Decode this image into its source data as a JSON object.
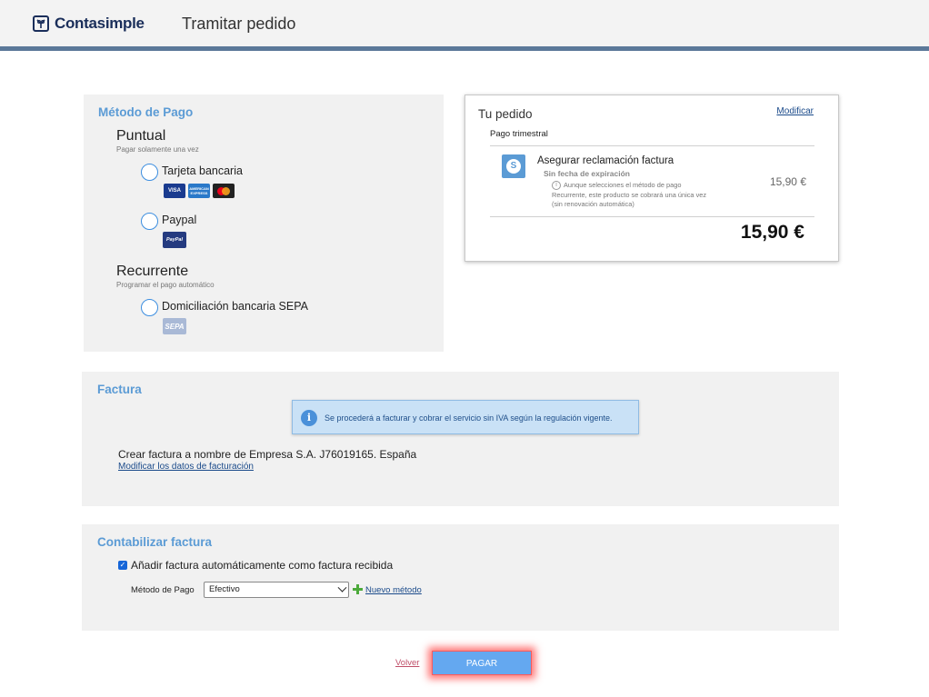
{
  "header": {
    "brand": "Contasimple",
    "title": "Tramitar pedido"
  },
  "payment": {
    "title": "Método de Pago",
    "puntual": {
      "title": "Puntual",
      "subtitle": "Pagar solamente una vez",
      "options": [
        {
          "label": "Tarjeta bancaria",
          "cards": [
            "VISA",
            "AMERICAN EXPRESS",
            "Mastercard"
          ]
        },
        {
          "label": "Paypal",
          "cards": [
            "PayPal"
          ]
        }
      ]
    },
    "recurrente": {
      "title": "Recurrente",
      "subtitle": "Programar el pago automático",
      "options": [
        {
          "label": "Domiciliación bancaria SEPA",
          "cards": [
            "SEPA"
          ]
        }
      ]
    }
  },
  "order": {
    "title": "Tu pedido",
    "modify": "Modificar",
    "period": "Pago trimestral",
    "product": {
      "name": "Asegurar reclamación factura",
      "expiry": "Sin fecha de expiración",
      "note": "Aunque selecciones el método de pago Recurrente, este producto se cobrará una única vez (sin renovación automática)",
      "price": "15,90 €"
    },
    "total": "15,90 €"
  },
  "invoice": {
    "title": "Factura",
    "info": "Se procederá a facturar y cobrar el servicio sin IVA según la regulación vigente.",
    "line": "Crear factura a nombre de Empresa S.A. J76019165. España",
    "modify_link": "Modificar los datos de facturación"
  },
  "accounting": {
    "title": "Contabilizar factura",
    "checkbox_label": "Añadir factura automáticamente como factura recibida",
    "checkbox_checked": true,
    "method_label": "Método de Pago",
    "method_value": "Efectivo",
    "new_method": "Nuevo método"
  },
  "footer": {
    "back": "Volver",
    "pay": "PAGAR"
  },
  "colors": {
    "accent": "#5b9bd5",
    "header_bar": "#5b7899",
    "pay_button": "#64a8f0",
    "pay_glow": "#ff5a5a"
  }
}
